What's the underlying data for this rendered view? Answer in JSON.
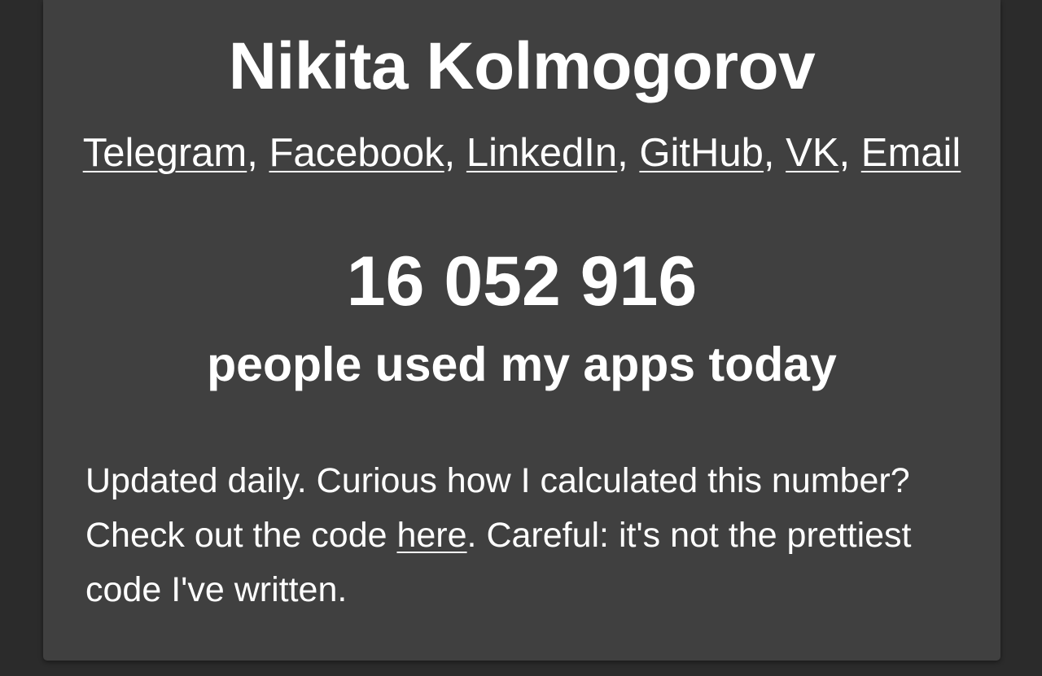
{
  "profile": {
    "name": "Nikita Kolmogorov"
  },
  "links": [
    {
      "label": "Telegram"
    },
    {
      "label": "Facebook"
    },
    {
      "label": "LinkedIn"
    },
    {
      "label": "GitHub"
    },
    {
      "label": "VK"
    },
    {
      "label": "Email"
    }
  ],
  "link_separator": ", ",
  "stats": {
    "count": "16 052 916",
    "caption": "people used my apps today"
  },
  "note": {
    "before_link": "Updated daily. Curious how I calculated this number? Check out the code ",
    "link_label": "here",
    "after_link": ". Careful: it's not the prettiest code I've written."
  },
  "colors": {
    "page_background": "#2b2b2b",
    "card_background": "#404040",
    "text": "#ffffff"
  }
}
